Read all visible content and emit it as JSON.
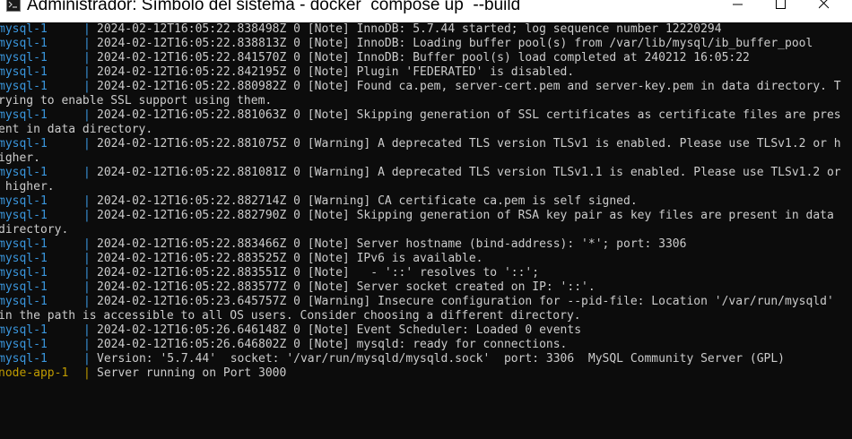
{
  "window": {
    "title": "Administrador: Símbolo del sistema - docker  compose up  --build",
    "icon": "cmd-icon",
    "controls": [
      "minimize-icon",
      "maximize-icon",
      "close-icon"
    ]
  },
  "colors": {
    "background": "#0c0c0c",
    "text": "#cccccc",
    "mysql_prefix": "#3a96dd",
    "node_prefix": "#c19c00",
    "titlebar": "#ffffff"
  },
  "console": {
    "lines": [
      {
        "service": "mysql-1",
        "pipe": "|",
        "text": "2024-02-12T16:05:22.838498Z 0 [Note] InnoDB: 5.7.44 started; log sequence number 12220294"
      },
      {
        "service": "mysql-1",
        "pipe": "|",
        "text": "2024-02-12T16:05:22.838813Z 0 [Note] InnoDB: Loading buffer pool(s) from /var/lib/mysql/ib_buffer_pool"
      },
      {
        "service": "mysql-1",
        "pipe": "|",
        "text": "2024-02-12T16:05:22.841570Z 0 [Note] InnoDB: Buffer pool(s) load completed at 240212 16:05:22"
      },
      {
        "service": "mysql-1",
        "pipe": "|",
        "text": "2024-02-12T16:05:22.842195Z 0 [Note] Plugin 'FEDERATED' is disabled."
      },
      {
        "service": "mysql-1",
        "pipe": "|",
        "text": "2024-02-12T16:05:22.880982Z 0 [Note] Found ca.pem, server-cert.pem and server-key.pem in data directory. T"
      },
      {
        "service": "",
        "pipe": "",
        "text": "rying to enable SSL support using them."
      },
      {
        "service": "mysql-1",
        "pipe": "|",
        "text": "2024-02-12T16:05:22.881063Z 0 [Note] Skipping generation of SSL certificates as certificate files are pres"
      },
      {
        "service": "",
        "pipe": "",
        "text": "ent in data directory."
      },
      {
        "service": "mysql-1",
        "pipe": "|",
        "text": "2024-02-12T16:05:22.881075Z 0 [Warning] A deprecated TLS version TLSv1 is enabled. Please use TLSv1.2 or h"
      },
      {
        "service": "",
        "pipe": "",
        "text": "igher."
      },
      {
        "service": "mysql-1",
        "pipe": "|",
        "text": "2024-02-12T16:05:22.881081Z 0 [Warning] A deprecated TLS version TLSv1.1 is enabled. Please use TLSv1.2 or"
      },
      {
        "service": "",
        "pipe": "",
        "text": " higher."
      },
      {
        "service": "mysql-1",
        "pipe": "|",
        "text": "2024-02-12T16:05:22.882714Z 0 [Warning] CA certificate ca.pem is self signed."
      },
      {
        "service": "mysql-1",
        "pipe": "|",
        "text": "2024-02-12T16:05:22.882790Z 0 [Note] Skipping generation of RSA key pair as key files are present in data"
      },
      {
        "service": "",
        "pipe": "",
        "text": "directory."
      },
      {
        "service": "mysql-1",
        "pipe": "|",
        "text": "2024-02-12T16:05:22.883466Z 0 [Note] Server hostname (bind-address): '*'; port: 3306"
      },
      {
        "service": "mysql-1",
        "pipe": "|",
        "text": "2024-02-12T16:05:22.883525Z 0 [Note] IPv6 is available."
      },
      {
        "service": "mysql-1",
        "pipe": "|",
        "text": "2024-02-12T16:05:22.883551Z 0 [Note]   - '::' resolves to '::';"
      },
      {
        "service": "mysql-1",
        "pipe": "|",
        "text": "2024-02-12T16:05:22.883577Z 0 [Note] Server socket created on IP: '::'."
      },
      {
        "service": "mysql-1",
        "pipe": "|",
        "text": "2024-02-12T16:05:23.645757Z 0 [Warning] Insecure configuration for --pid-file: Location '/var/run/mysqld'"
      },
      {
        "service": "",
        "pipe": "",
        "text": "in the path is accessible to all OS users. Consider choosing a different directory."
      },
      {
        "service": "mysql-1",
        "pipe": "|",
        "text": "2024-02-12T16:05:26.646148Z 0 [Note] Event Scheduler: Loaded 0 events"
      },
      {
        "service": "mysql-1",
        "pipe": "|",
        "text": "2024-02-12T16:05:26.646802Z 0 [Note] mysqld: ready for connections."
      },
      {
        "service": "mysql-1",
        "pipe": "|",
        "text": "Version: '5.7.44'  socket: '/var/run/mysqld/mysqld.sock'  port: 3306  MySQL Community Server (GPL)"
      },
      {
        "service": "node-app-1",
        "pipe": "|",
        "text": "Server running on Port 3000"
      }
    ]
  }
}
